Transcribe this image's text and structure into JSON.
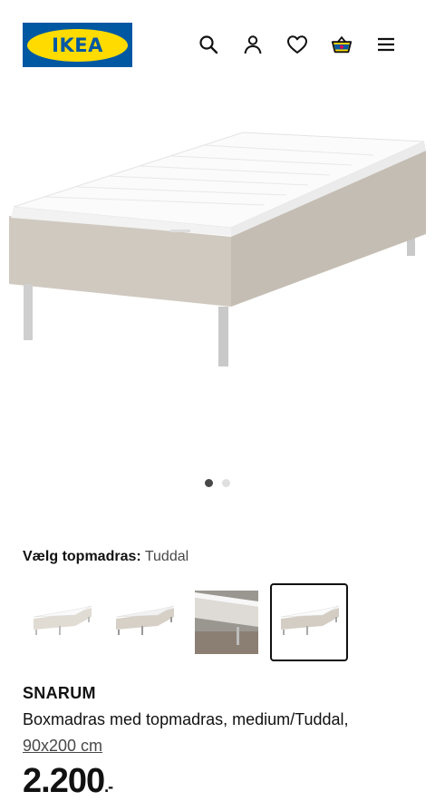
{
  "brand": {
    "logo_text": "IKEA",
    "primary_color": "#0058a3",
    "secondary_color": "#ffdb00"
  },
  "header": {
    "icons": [
      "search-icon",
      "account-icon",
      "heart-icon",
      "basket-icon",
      "menu-icon"
    ]
  },
  "gallery": {
    "image_count": 2,
    "active_index": 0
  },
  "option": {
    "label": "Vælg topmadras:",
    "value": "Tuddal",
    "thumbnails": [
      {
        "alt": "Tuddal topmadras variant 1",
        "selected": false
      },
      {
        "alt": "Tuddal topmadras variant 2",
        "selected": false
      },
      {
        "alt": "Tuddal topmadras variant 3",
        "selected": false
      },
      {
        "alt": "Tuddal topmadras variant 4",
        "selected": true
      }
    ]
  },
  "product": {
    "name": "SNARUM",
    "description": "Boxmadras med topmadras, medium/Tuddal,",
    "size": "90x200 cm",
    "price": "2.200",
    "price_suffix": ".-"
  }
}
